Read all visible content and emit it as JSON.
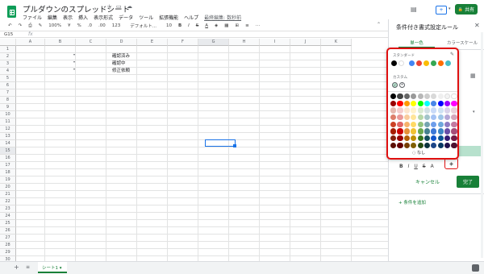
{
  "app": {
    "doc_title": "プルダウンのスプレッドシート",
    "menu": [
      "ファイル",
      "編集",
      "表示",
      "挿入",
      "表示形式",
      "データ",
      "ツール",
      "拡張機能",
      "ヘルプ"
    ],
    "last_edit": "最終編集: 数秒前",
    "share_label": "共有"
  },
  "toolbar": {
    "zoom": "100%",
    "currency": "¥",
    "percent": "%",
    "dec1": ".0",
    "dec2": ".00",
    "numfmt": "123",
    "font": "デフォルト...",
    "size": "10"
  },
  "formula": {
    "cell_ref": "G15",
    "fx": "fx"
  },
  "sheet": {
    "columns": [
      "A",
      "B",
      "C",
      "D",
      "E",
      "F",
      "G",
      "H",
      "I",
      "J",
      "K"
    ],
    "rows": [
      "1",
      "2",
      "3",
      "4",
      "5",
      "6",
      "7",
      "8",
      "9",
      "10",
      "11",
      "12",
      "13",
      "14",
      "15",
      "16",
      "17",
      "18",
      "19",
      "20",
      "21",
      "22",
      "23",
      "24",
      "25",
      "26",
      "27",
      "28",
      "29",
      "30"
    ],
    "d_values": [
      "確認済み",
      "確認中",
      "修正依頼"
    ],
    "tab_name": "シート1"
  },
  "panel": {
    "title": "条件付き書式設定ルール",
    "tab_single": "単一色",
    "tab_scale": "カラースケール",
    "cancel_label": "キャンセル",
    "done_label": "完了",
    "add_rule_label": "条件を追加"
  },
  "picker": {
    "standard_label": "スタンダード",
    "custom_label": "カスタム",
    "none_label": "なし",
    "standard_colors": [
      "#000000",
      "#ffffff",
      "#4285f4",
      "#ea4335",
      "#fbbc04",
      "#34a853",
      "#ff6d01",
      "#46bdc6"
    ],
    "grid": [
      [
        "#000000",
        "#434343",
        "#666666",
        "#999999",
        "#b7b7b7",
        "#cccccc",
        "#d9d9d9",
        "#efefef",
        "#f3f3f3",
        "#ffffff"
      ],
      [
        "#980000",
        "#ff0000",
        "#ff9900",
        "#ffff00",
        "#00ff00",
        "#00ffff",
        "#4a86e8",
        "#0000ff",
        "#9900ff",
        "#ff00ff"
      ],
      [
        "#e6b8af",
        "#f4cccc",
        "#fce5cd",
        "#fff2cc",
        "#d9ead3",
        "#d0e0e3",
        "#c9daf8",
        "#cfe2f3",
        "#d9d2e9",
        "#ead1dc"
      ],
      [
        "#dd7e6b",
        "#ea9999",
        "#f9cb9c",
        "#ffe599",
        "#b6d7a8",
        "#a2c4c9",
        "#a4c2f4",
        "#9fc5e8",
        "#b4a7d6",
        "#d5a6bd"
      ],
      [
        "#cc4125",
        "#e06666",
        "#f6b26b",
        "#ffd966",
        "#93c47d",
        "#76a5af",
        "#6d9eeb",
        "#6fa8dc",
        "#8e7cc3",
        "#c27ba0"
      ],
      [
        "#a61c00",
        "#cc0000",
        "#e69138",
        "#f1c232",
        "#6aa84f",
        "#45818e",
        "#3c78d8",
        "#3d85c6",
        "#674ea7",
        "#a64d79"
      ],
      [
        "#85200c",
        "#990000",
        "#b45f06",
        "#bf9000",
        "#38761d",
        "#134f5c",
        "#1155cc",
        "#0b5394",
        "#351c75",
        "#741b47"
      ],
      [
        "#5b0f00",
        "#660000",
        "#783f04",
        "#7f6000",
        "#274e13",
        "#0c343d",
        "#1c4587",
        "#073763",
        "#20124d",
        "#4c1130"
      ]
    ]
  },
  "colors": {
    "accent_green": "#188038",
    "highlight_red": "#e01010",
    "select_blue": "#1a73e8"
  }
}
